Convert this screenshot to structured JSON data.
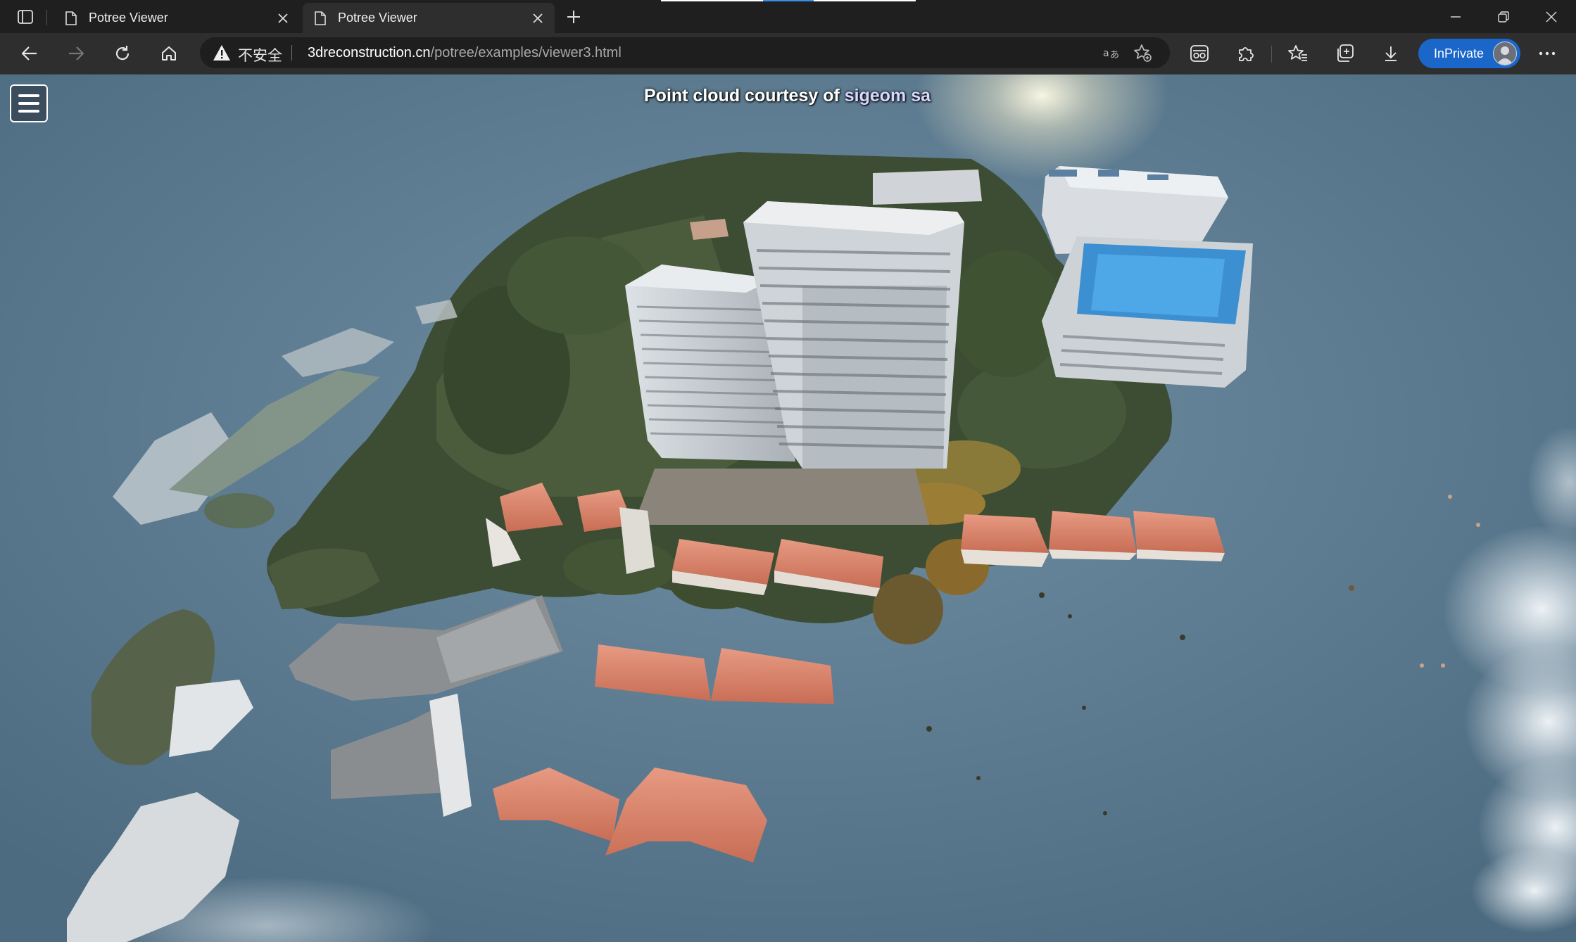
{
  "browser": {
    "tabs": [
      {
        "title": "Potree Viewer",
        "active": false
      },
      {
        "title": "Potree Viewer",
        "active": true
      }
    ],
    "address": {
      "security_label": "不安全",
      "url_host": "3dreconstruction.cn",
      "url_path": "/potree/examples/viewer3.html"
    },
    "inprivate_label": "InPrivate",
    "accent": "#1a66c9"
  },
  "viewer": {
    "credit_prefix": "Point cloud courtesy of",
    "credit_link": "sigeom sa",
    "sky_color": "#5a7a90"
  },
  "icons": [
    "tab-actions-icon",
    "page-icon",
    "close-icon",
    "plus-icon",
    "minimize-icon",
    "restore-icon",
    "window-close-icon",
    "back-icon",
    "forward-icon",
    "refresh-icon",
    "home-icon",
    "warning-icon",
    "read-aloud-icon",
    "add-favorite-icon",
    "browser-essentials-icon",
    "extensions-icon",
    "favorites-icon",
    "collections-icon",
    "download-icon",
    "more-icon",
    "hamburger-icon"
  ]
}
